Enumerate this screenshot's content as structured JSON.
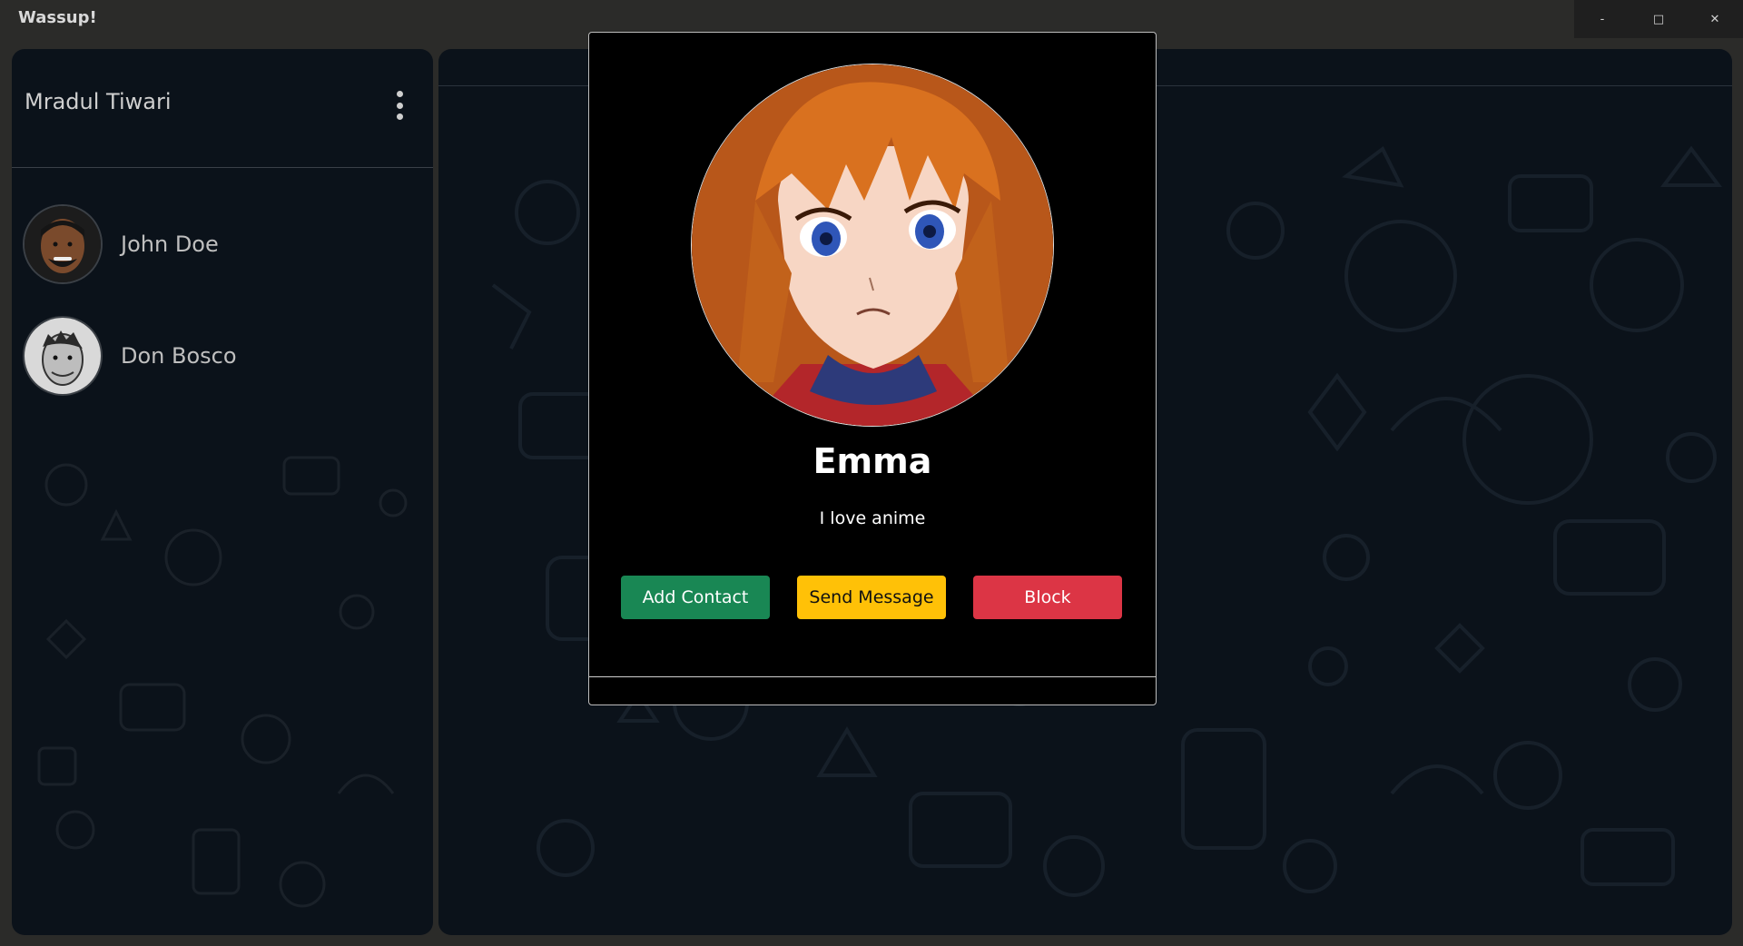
{
  "window": {
    "title": "Wassup!",
    "controls": {
      "minimize": "-",
      "maximize": "□",
      "close": "✕"
    }
  },
  "sidebar": {
    "user_name": "Mradul Tiwari",
    "contacts": [
      {
        "name": "John Doe"
      },
      {
        "name": "Don Bosco"
      }
    ]
  },
  "profile_modal": {
    "name": "Emma",
    "status": "I love anime",
    "buttons": {
      "add_contact": "Add Contact",
      "send_message": "Send Message",
      "block": "Block"
    }
  },
  "colors": {
    "add_contact": "#198754",
    "send_message": "#ffc107",
    "block": "#dc3545",
    "background": "#0b121a"
  }
}
